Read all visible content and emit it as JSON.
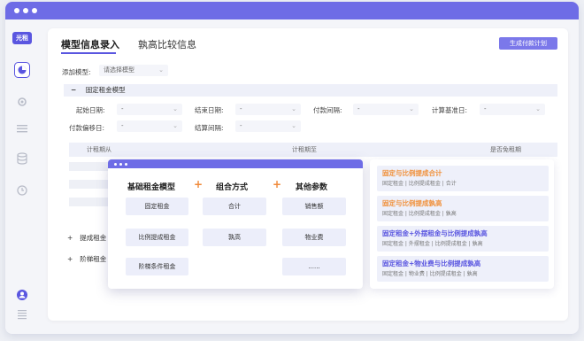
{
  "logo": "光租",
  "tabs": [
    {
      "label": "模型信息录入",
      "active": true
    },
    {
      "label": "孰高比较信息",
      "active": false
    }
  ],
  "generate_button": "生成付款计划",
  "add_model": {
    "label": "添加模型:",
    "placeholder": "请选择模型"
  },
  "fixed_section": {
    "toggle": "−",
    "title": "固定租金模型"
  },
  "fields": {
    "start_date": {
      "label": "起始日期:",
      "value": "-"
    },
    "end_date": {
      "label": "结束日期:",
      "value": "-"
    },
    "pay_interval": {
      "label": "付款间隔:",
      "value": "-"
    },
    "calc_base_date": {
      "label": "计算基准日:",
      "value": "-"
    },
    "pay_offset": {
      "label": "付款偏移日:",
      "value": "-"
    },
    "settle_interval": {
      "label": "结算间隔:",
      "value": "-"
    }
  },
  "table_headers": [
    "计租期从",
    "计租期至",
    "是否免租期"
  ],
  "expanders": [
    {
      "icon": "+",
      "label": "提成租金"
    },
    {
      "icon": "+",
      "label": "阶梯租金"
    }
  ],
  "popup": {
    "columns": [
      "基础租金模型",
      "组合方式",
      "其他参数"
    ],
    "plus_symbol": "+",
    "base_models": [
      "固定租金",
      "比例提成租金",
      "阶梯条件租金"
    ],
    "combine_methods": [
      "合计",
      "孰高"
    ],
    "other_params": [
      "销售额",
      "物业费",
      "......"
    ]
  },
  "combo_cards": [
    {
      "title": "固定与比例提成合计",
      "title_color": "#f0913c",
      "tags": [
        "固定租金",
        "比例提成租金",
        "合计"
      ]
    },
    {
      "title": "固定与比例提成孰高",
      "title_color": "#f0913c",
      "tags": [
        "固定租金",
        "比例提成租金",
        "孰高"
      ]
    },
    {
      "title": "固定租金+外摆租金与比例提成孰高",
      "title_color": "#5a56e0",
      "tags": [
        "固定租金",
        "外摆租金",
        "比例提成租金",
        "孰高"
      ]
    },
    {
      "title": "固定租金+物业费与比例提成孰高",
      "title_color": "#5a56e0",
      "tags": [
        "固定租金",
        "物业费",
        "比例提成租金",
        "孰高"
      ]
    }
  ],
  "colors": {
    "accent": "#6e6ce6",
    "orange": "#f0913c",
    "purple": "#5a56e0"
  }
}
